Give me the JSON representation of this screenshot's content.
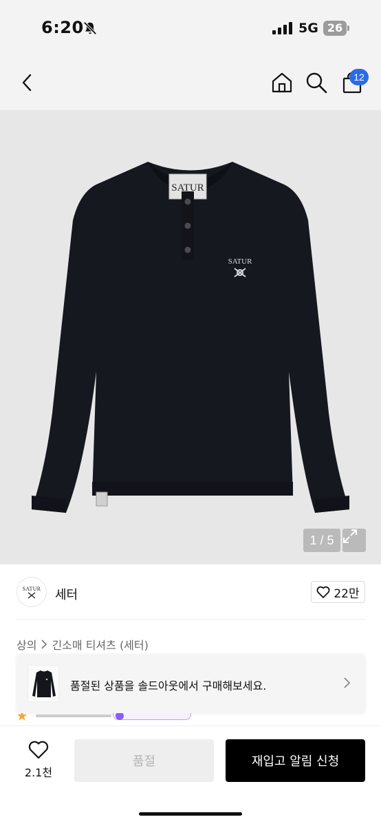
{
  "status_bar": {
    "time": "6:20",
    "network": "5G",
    "battery": "26"
  },
  "header": {
    "cart_badge": "12"
  },
  "product": {
    "image_counter": "1 / 5",
    "garment_label": "SATUR",
    "chest_logo": "SATUR"
  },
  "brand": {
    "logo_text": "SATUR",
    "name": "세터",
    "like_count": "22만"
  },
  "breadcrumb": {
    "category": "상의",
    "subcategory": "긴소매 티셔츠 (세터)"
  },
  "promo": {
    "text": "품절된 상품을 솔드아웃에서 구매해보세요."
  },
  "bottom_bar": {
    "wish_count": "2.1천",
    "soldout_label": "품절",
    "restock_label": "재입고 알림 신청"
  },
  "colors": {
    "badge": "#2a6ce8",
    "primary_button": "#000000",
    "disabled_button": "#eeeeee"
  }
}
